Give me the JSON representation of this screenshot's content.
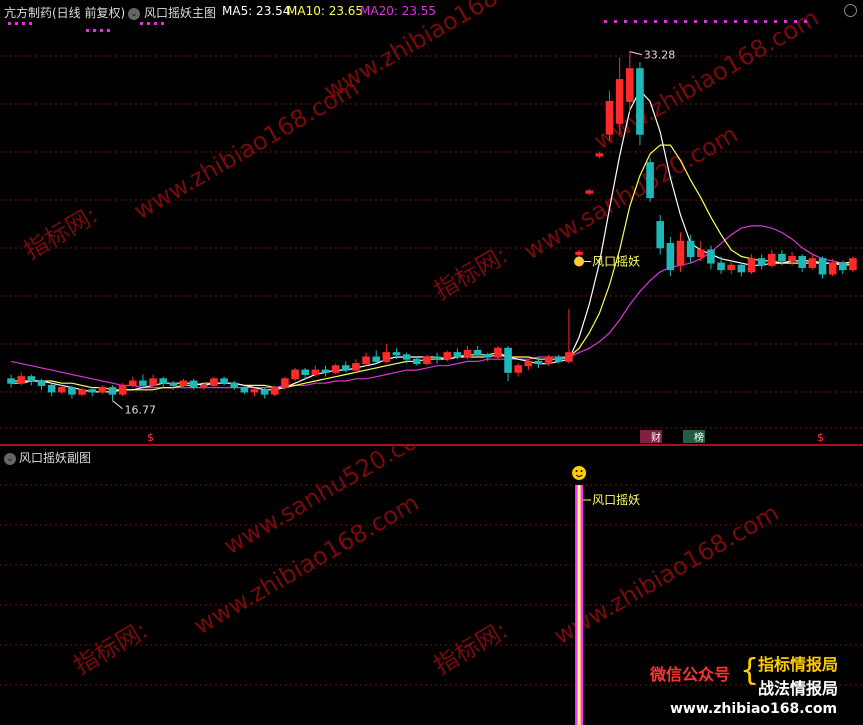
{
  "main_header": {
    "stock_name": "亢方制药(日线 前复权)",
    "indicator_name": "风口摇妖主图",
    "ma5_label": "MA5: 23.54",
    "ma10_label": "MA10: 23.65",
    "ma20_label": "MA20: 23.55"
  },
  "sub_header": {
    "indicator_name": "风口摇妖副图"
  },
  "colors": {
    "up": "#ff2a2a",
    "down": "#1fb8b8",
    "ma5": "#ffffff",
    "ma10": "#ffff55",
    "ma20": "#dd33dd",
    "grid": "#7a1010",
    "signal_bar_outer": "#ff33ff",
    "signal_bar_inner": "#ffff66"
  },
  "annotations": {
    "high_price": "33.28",
    "low_price": "16.77",
    "signal_main": "风口摇妖",
    "signal_sub": "风口摇妖",
    "tag_report": "财",
    "tag_rank": "榜"
  },
  "watermarks": {
    "site1": "www.zhibiao168.com",
    "site2": "www.sanhu520.com",
    "brand": "指标网:"
  },
  "promo": {
    "label": "微信公众号",
    "line1": "指标情报局",
    "line2": "战法情报局",
    "footer_url": "www.zhibiao168.com"
  },
  "chart_data": {
    "type": "candlestick",
    "price_range": [
      15.5,
      34.5
    ],
    "candles": [
      [
        18.3,
        18.1,
        18.5,
        17.9
      ],
      [
        18.1,
        18.4,
        18.6,
        18.0
      ],
      [
        18.4,
        18.2,
        18.5,
        18.0
      ],
      [
        18.2,
        18.0,
        18.3,
        17.8
      ],
      [
        18.0,
        17.7,
        18.1,
        17.5
      ],
      [
        17.7,
        17.9,
        18.0,
        17.6
      ],
      [
        17.9,
        17.6,
        18.0,
        17.4
      ],
      [
        17.6,
        17.8,
        17.9,
        17.5
      ],
      [
        17.8,
        17.7,
        17.9,
        17.5
      ],
      [
        17.7,
        17.9,
        18.0,
        17.6
      ],
      [
        17.9,
        17.6,
        18.0,
        17.3
      ],
      [
        17.6,
        18.0,
        18.1,
        17.5
      ],
      [
        18.0,
        18.2,
        18.4,
        17.9
      ],
      [
        18.2,
        18.0,
        18.5,
        17.9
      ],
      [
        18.0,
        18.3,
        18.5,
        17.9
      ],
      [
        18.3,
        18.1,
        18.4,
        17.9
      ],
      [
        18.1,
        18.0,
        18.2,
        17.8
      ],
      [
        18.0,
        18.2,
        18.3,
        17.9
      ],
      [
        18.2,
        17.9,
        18.3,
        17.8
      ],
      [
        17.9,
        18.0,
        18.1,
        17.8
      ],
      [
        18.0,
        18.3,
        18.4,
        17.9
      ],
      [
        18.3,
        18.1,
        18.4,
        18.0
      ],
      [
        18.1,
        17.9,
        18.2,
        17.8
      ],
      [
        17.9,
        17.7,
        18.0,
        17.6
      ],
      [
        17.7,
        17.8,
        17.9,
        17.5
      ],
      [
        17.8,
        17.6,
        17.9,
        17.4
      ],
      [
        17.6,
        17.9,
        18.0,
        17.5
      ],
      [
        17.9,
        18.3,
        18.4,
        17.8
      ],
      [
        18.3,
        18.7,
        18.8,
        18.2
      ],
      [
        18.7,
        18.5,
        18.8,
        18.3
      ],
      [
        18.5,
        18.7,
        18.9,
        18.4
      ],
      [
        18.7,
        18.6,
        18.9,
        18.4
      ],
      [
        18.6,
        18.9,
        19.0,
        18.5
      ],
      [
        18.9,
        18.7,
        19.1,
        18.6
      ],
      [
        18.7,
        19.0,
        19.2,
        18.6
      ],
      [
        19.0,
        19.3,
        19.5,
        18.9
      ],
      [
        19.3,
        19.1,
        19.6,
        19.0
      ],
      [
        19.1,
        19.5,
        19.9,
        19.0
      ],
      [
        19.5,
        19.4,
        19.7,
        19.2
      ],
      [
        19.4,
        19.2,
        19.5,
        19.0
      ],
      [
        19.2,
        19.0,
        19.3,
        18.9
      ],
      [
        19.0,
        19.3,
        19.4,
        18.9
      ],
      [
        19.3,
        19.2,
        19.5,
        19.0
      ],
      [
        19.2,
        19.5,
        19.6,
        19.1
      ],
      [
        19.5,
        19.3,
        19.7,
        19.2
      ],
      [
        19.3,
        19.6,
        19.8,
        19.2
      ],
      [
        19.6,
        19.4,
        19.8,
        19.3
      ],
      [
        19.4,
        19.3,
        19.5,
        19.1
      ],
      [
        19.3,
        19.7,
        19.8,
        19.2
      ],
      [
        19.7,
        18.6,
        19.8,
        18.2
      ],
      [
        18.6,
        18.9,
        19.0,
        18.4
      ],
      [
        18.9,
        19.1,
        19.2,
        18.7
      ],
      [
        19.1,
        19.0,
        19.3,
        18.8
      ],
      [
        19.0,
        19.3,
        19.4,
        18.9
      ],
      [
        19.3,
        19.1,
        19.4,
        19.0
      ],
      [
        19.1,
        19.5,
        21.5,
        19.0
      ],
      [
        24.0,
        24.1,
        24.2,
        23.9
      ],
      [
        26.8,
        26.9,
        27.0,
        26.7
      ],
      [
        28.5,
        28.6,
        28.7,
        28.4
      ],
      [
        29.5,
        31.0,
        31.5,
        29.2
      ],
      [
        30.0,
        32.0,
        33.0,
        29.5
      ],
      [
        31.0,
        32.5,
        33.28,
        30.5
      ],
      [
        32.5,
        29.5,
        32.8,
        29.0
      ],
      [
        28.2,
        26.6,
        28.4,
        26.4
      ],
      [
        25.5,
        24.3,
        25.8,
        24.0
      ],
      [
        24.5,
        23.3,
        24.8,
        23.0
      ],
      [
        23.5,
        24.6,
        25.0,
        23.2
      ],
      [
        24.6,
        23.9,
        24.9,
        23.6
      ],
      [
        23.9,
        24.2,
        24.6,
        23.7
      ],
      [
        24.2,
        23.6,
        24.4,
        23.3
      ],
      [
        23.6,
        23.3,
        23.9,
        23.1
      ],
      [
        23.3,
        23.5,
        23.7,
        23.1
      ],
      [
        23.5,
        23.2,
        23.6,
        23.0
      ],
      [
        23.2,
        23.8,
        24.0,
        23.1
      ],
      [
        23.8,
        23.5,
        24.0,
        23.3
      ],
      [
        23.5,
        24.0,
        24.2,
        23.4
      ],
      [
        24.0,
        23.7,
        24.2,
        23.5
      ],
      [
        23.7,
        23.9,
        24.1,
        23.5
      ],
      [
        23.9,
        23.4,
        24.0,
        23.2
      ],
      [
        23.4,
        23.8,
        24.0,
        23.3
      ],
      [
        23.8,
        23.1,
        23.9,
        22.9
      ],
      [
        23.1,
        23.6,
        23.8,
        23.0
      ],
      [
        23.6,
        23.3,
        23.7,
        23.1
      ],
      [
        23.3,
        23.8,
        23.9,
        23.2
      ]
    ],
    "ma5": [
      18.1,
      18.1,
      18.2,
      18.2,
      18.1,
      18.0,
      17.9,
      17.8,
      17.7,
      17.7,
      17.7,
      17.8,
      17.8,
      17.9,
      18.0,
      18.1,
      18.1,
      18.1,
      18.1,
      18.0,
      18.1,
      18.1,
      18.1,
      18.0,
      17.9,
      17.8,
      17.8,
      17.9,
      18.1,
      18.3,
      18.5,
      18.6,
      18.7,
      18.7,
      18.8,
      18.9,
      19.0,
      19.2,
      19.3,
      19.3,
      19.3,
      19.3,
      19.3,
      19.2,
      19.3,
      19.4,
      19.4,
      19.4,
      19.5,
      19.3,
      19.2,
      19.1,
      19.0,
      19.0,
      19.1,
      19.2,
      20.2,
      21.7,
      23.6,
      26.1,
      28.5,
      30.6,
      31.5,
      31.0,
      29.6,
      27.5,
      25.8,
      24.5,
      24.2,
      24.0,
      23.8,
      23.7,
      23.6,
      23.5,
      23.5,
      23.6,
      23.6,
      23.7,
      23.7,
      23.7,
      23.6,
      23.6,
      23.5,
      23.54
    ],
    "ma10": [
      18.2,
      18.2,
      18.2,
      18.2,
      18.2,
      18.1,
      18.1,
      18.0,
      17.9,
      17.9,
      17.8,
      17.8,
      17.8,
      17.8,
      17.8,
      17.9,
      17.9,
      18.0,
      18.0,
      18.1,
      18.1,
      18.1,
      18.1,
      18.0,
      18.0,
      18.0,
      17.9,
      17.9,
      18.0,
      18.1,
      18.2,
      18.3,
      18.4,
      18.5,
      18.6,
      18.7,
      18.8,
      18.9,
      19.0,
      19.1,
      19.1,
      19.2,
      19.2,
      19.2,
      19.3,
      19.3,
      19.3,
      19.3,
      19.4,
      19.3,
      19.3,
      19.3,
      19.2,
      19.2,
      19.2,
      19.3,
      19.7,
      20.4,
      21.3,
      22.6,
      24.2,
      26.2,
      27.6,
      28.6,
      29.0,
      29.0,
      28.3,
      27.4,
      26.6,
      25.7,
      24.9,
      24.2,
      23.9,
      23.8,
      23.7,
      23.7,
      23.6,
      23.6,
      23.6,
      23.6,
      23.6,
      23.6,
      23.6,
      23.65
    ],
    "ma20": [
      19.1,
      19.0,
      18.9,
      18.8,
      18.7,
      18.6,
      18.5,
      18.4,
      18.3,
      18.2,
      18.1,
      18.0,
      18.0,
      17.9,
      17.9,
      17.9,
      17.9,
      17.9,
      17.9,
      17.9,
      17.9,
      17.9,
      17.9,
      17.9,
      17.9,
      17.9,
      17.9,
      18.0,
      18.0,
      18.0,
      18.1,
      18.1,
      18.2,
      18.2,
      18.3,
      18.3,
      18.4,
      18.5,
      18.6,
      18.7,
      18.7,
      18.8,
      18.9,
      18.9,
      19.0,
      19.1,
      19.1,
      19.2,
      19.2,
      19.2,
      19.2,
      19.2,
      19.3,
      19.3,
      19.3,
      19.3,
      19.5,
      19.7,
      20.0,
      20.4,
      21.0,
      21.7,
      22.3,
      22.8,
      23.2,
      23.4,
      23.5,
      23.6,
      23.8,
      24.1,
      24.5,
      24.9,
      25.2,
      25.3,
      25.3,
      25.2,
      25.0,
      24.7,
      24.3,
      24.0,
      23.8,
      23.7,
      23.6,
      23.55
    ],
    "signal_index": 56
  }
}
